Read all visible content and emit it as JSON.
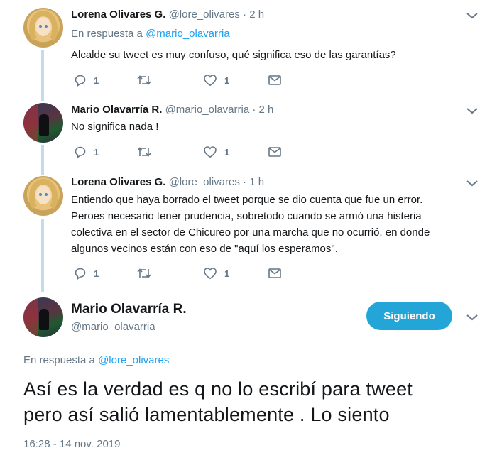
{
  "thread": [
    {
      "name": "Lorena Olivares G.",
      "handle": "@lore_olivares",
      "time": "2 h",
      "reply_prefix": "En respuesta a",
      "reply_mention": "@mario_olavarria",
      "text": "Alcalde su tweet es muy confuso, qué significa eso de las garantías?",
      "reply_count": "1",
      "like_count": "1",
      "avatar_icon": "user-avatar-lorena"
    },
    {
      "name": "Mario Olavarría R.",
      "handle": "@mario_olavarria",
      "time": "2 h",
      "text": "No significa nada !",
      "reply_count": "1",
      "like_count": "1",
      "avatar_icon": "user-avatar-mario"
    },
    {
      "name": "Lorena Olivares G.",
      "handle": "@lore_olivares",
      "time": "1 h",
      "text_lines": [
        "Entiendo que haya borrado el tweet porque se dio cuenta que fue un error.",
        "Peroes necesario tener prudencia, sobretodo cuando se armó una histeria",
        "colectiva en el sector de Chicureo por una marcha que no ocurrió, en donde",
        "algunos vecinos están con eso de \"aquí los esperamos\"."
      ],
      "reply_count": "1",
      "like_count": "1",
      "avatar_icon": "user-avatar-lorena"
    }
  ],
  "separator": "·",
  "main_tweet": {
    "name": "Mario Olavarría R.",
    "handle": "@mario_olavarria",
    "follow_label": "Siguiendo",
    "reply_prefix": "En respuesta a",
    "reply_mention": "@lore_olivares",
    "text_lines": [
      "Así es la verdad es q no lo escribí para tweet",
      "pero así salió lamentablemente . Lo siento"
    ],
    "timestamp": "16:28 - 14 nov. 2019"
  },
  "colors": {
    "link": "#1da1f2",
    "muted": "#657786",
    "thread_line": "#c6dbe9",
    "follow_button": "#24a5d8"
  },
  "icons": [
    "reply-icon",
    "retweet-icon",
    "like-icon",
    "direct-message-icon",
    "chevron-down-icon"
  ]
}
